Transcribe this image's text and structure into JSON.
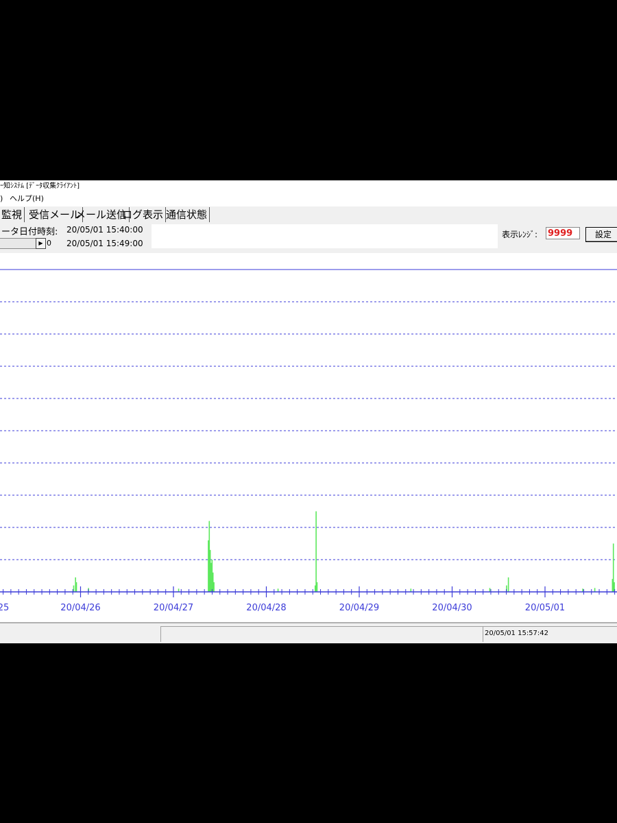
{
  "window": {
    "title": "ｰ知ｼｽﾃﾑ [ﾃﾞｰﾀ収集ｸﾗｲｱﾝﾄ]"
  },
  "menu": {
    "items": [
      {
        "label": ")"
      },
      {
        "label": "ヘルプ(H)"
      }
    ]
  },
  "tabs": [
    {
      "label": "監視",
      "active": true
    },
    {
      "label": "受信メール"
    },
    {
      "label": "メール送信"
    },
    {
      "label": "ログ表示"
    },
    {
      "label": "通信状態"
    }
  ],
  "info": {
    "data_datetime_label": "ータ日付時刻:",
    "data_datetime_value": "20/05/01 15:40:00",
    "slider_value_label": "0",
    "slider_datetime_value": "20/05/01 15:49:00"
  },
  "controls": {
    "range_label": "表示ﾚﾝｼﾞ:",
    "range_value": "9999",
    "settings_label": "設定"
  },
  "status": {
    "timestamp": "20/05/01 15:57:42"
  },
  "colors": {
    "grid": "#3a3ad8",
    "bar": "#5ce85c",
    "range_value": "#e02020"
  },
  "chart_data": {
    "type": "bar",
    "x_tick_labels": [
      "25",
      "20/04/26",
      "20/04/27",
      "20/04/28",
      "20/04/29",
      "20/04/30",
      "20/05/01"
    ],
    "grid_lines": 10,
    "grid": true,
    "x_range": [
      25.9,
      32.6
    ],
    "y_range": [
      0,
      1
    ],
    "bars": [
      {
        "x": 25.92,
        "y": 0.02
      },
      {
        "x": 25.94,
        "y": 0.045
      },
      {
        "x": 25.95,
        "y": 0.03
      },
      {
        "x": 26.08,
        "y": 0.012
      },
      {
        "x": 27.05,
        "y": 0.01
      },
      {
        "x": 27.37,
        "y": 0.16
      },
      {
        "x": 27.38,
        "y": 0.22
      },
      {
        "x": 27.39,
        "y": 0.13
      },
      {
        "x": 27.4,
        "y": 0.09
      },
      {
        "x": 27.41,
        "y": 0.1
      },
      {
        "x": 27.42,
        "y": 0.06
      },
      {
        "x": 27.43,
        "y": 0.03
      },
      {
        "x": 28.12,
        "y": 0.01
      },
      {
        "x": 28.52,
        "y": 0.02
      },
      {
        "x": 28.53,
        "y": 0.25
      },
      {
        "x": 28.54,
        "y": 0.03
      },
      {
        "x": 29.55,
        "y": 0.01
      },
      {
        "x": 30.4,
        "y": 0.012
      },
      {
        "x": 30.58,
        "y": 0.02
      },
      {
        "x": 30.6,
        "y": 0.045
      },
      {
        "x": 31.4,
        "y": 0.01
      },
      {
        "x": 31.53,
        "y": 0.012
      },
      {
        "x": 31.72,
        "y": 0.04
      },
      {
        "x": 31.73,
        "y": 0.15
      },
      {
        "x": 31.74,
        "y": 0.03
      }
    ]
  }
}
